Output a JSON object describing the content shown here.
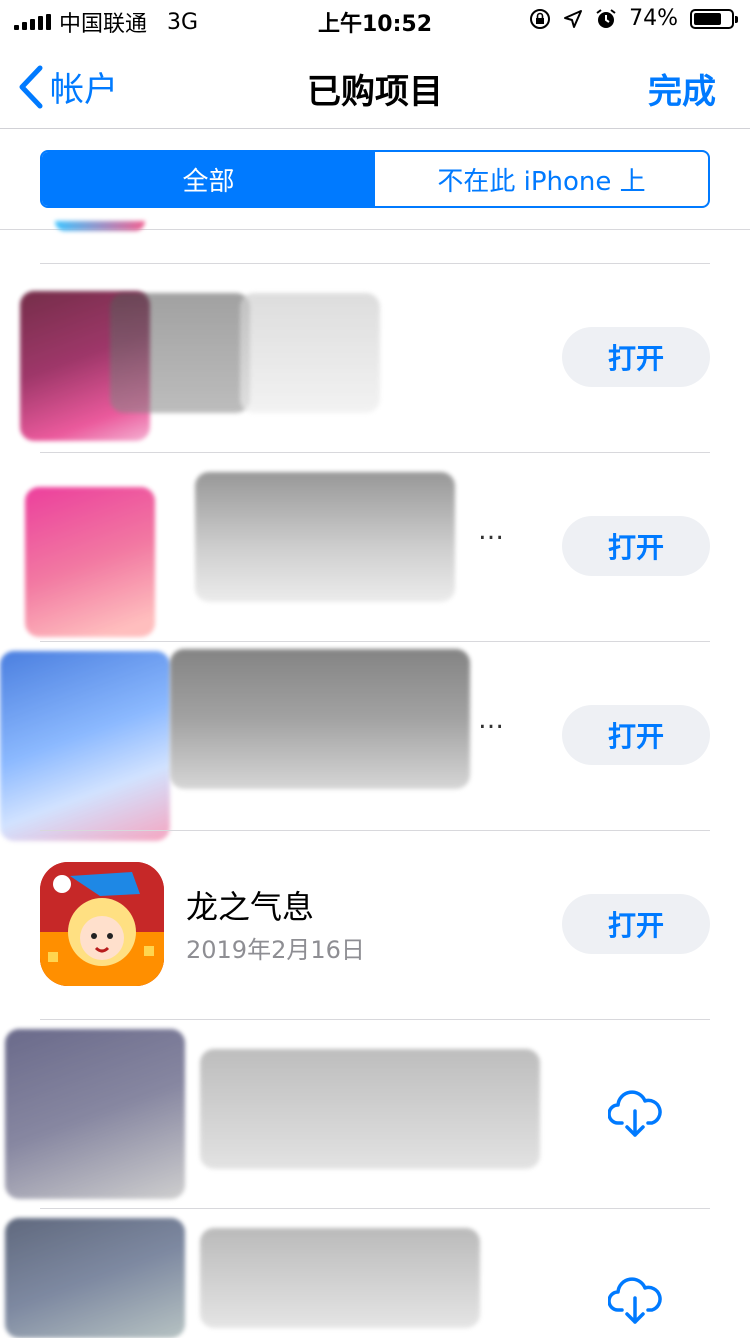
{
  "status_bar": {
    "carrier": "中国联通",
    "network": "3G",
    "time": "上午10:52",
    "battery": "74%",
    "battery_level": 0.74,
    "icons": [
      "lock-rotation-icon",
      "location-icon",
      "alarm-icon"
    ]
  },
  "nav": {
    "back_label": "帐户",
    "title": "已购项目",
    "done_label": "完成"
  },
  "segments": [
    {
      "label": "全部",
      "selected": true
    },
    {
      "label": "不在此 iPhone 上",
      "selected": false
    }
  ],
  "rows": [
    {
      "name": "",
      "date": "",
      "action": "打开"
    },
    {
      "name": "",
      "date": "",
      "action": "打开"
    },
    {
      "name": "",
      "date": "",
      "action": "打开"
    },
    {
      "name": "龙之气息",
      "date": "2019年2月16日",
      "action": "打开"
    },
    {
      "name": "",
      "date": "",
      "action": "download-cloud-icon"
    },
    {
      "name": "",
      "date": "",
      "action": "download-cloud-icon"
    }
  ],
  "colors": {
    "accent": "#007aff",
    "button_bg": "#eef0f4",
    "secondary_text": "#8e8e93"
  }
}
